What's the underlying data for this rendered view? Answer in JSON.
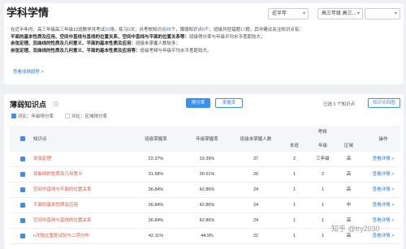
{
  "header": {
    "title": "学科学情",
    "range_select": "近半年",
    "class_select": "高三年级 高三..."
  },
  "summary": {
    "line1_a": "在近半年内，高三年级高三年级12班数学共考试",
    "exams": "15",
    "line1_b": "场，练习",
    "practice": "0",
    "line1_c": "次，共考核知识点",
    "kp_total": "28",
    "line1_d": "个，薄弱知识点",
    "weak": "8",
    "line1_e": "个，班级共性错题",
    "common_wrong": "17",
    "line1_f": "题，其中建议关注知识点有：",
    "line2_bold": "平面的基本性质及应用、空间中直线与直线的位置关系、空间中直线与平面的位置关系等：",
    "line2_rest": "班级得分率与年级平均水平差距较大；",
    "line3_bold": "余弦定理、双曲线的性质及几何意义、平面的基本性质及应用：",
    "line3_rest": "班级未掌握人数较多；",
    "line4_bold": "余弦定理、双曲线的性质及几何意义、平面的基本性质及应用等：",
    "line4_rest": "班级考频与年级平均水平差距较大。",
    "detail_link": "查看成绩趋势 >"
  },
  "weak_section": {
    "title": "薄弱知识点",
    "help": "?",
    "tab_active": "得分率",
    "tab_inactive": "掌握率",
    "selected_prefix": "已选",
    "selected_count": "5",
    "selected_suffix": "个知识点",
    "analyze_button": "知识点四图",
    "compare_prefix_1": "对比：",
    "compare_label_1": "年级得分率",
    "compare_prefix_2": "对比：",
    "compare_label_2": "区域得分率"
  },
  "table": {
    "headers": {
      "kp": "知识点",
      "class_rate": "班级掌握率",
      "grade_rate": "年级掌握率",
      "unmastered": "班级未掌握人数",
      "freq": "考频",
      "freq_class": "本班",
      "freq_grade": "年级",
      "freq_area": "区域",
      "action": "操作"
    },
    "rows": [
      {
        "kp": "余弦定理",
        "class_rate": "22.37%",
        "grade_rate": "19.39%",
        "unmastered": "37",
        "f_class": "2",
        "f_grade": "三年级",
        "f_area": "高",
        "action": "查看详情 >"
      },
      {
        "kp": "双曲线的性质及几何意义",
        "class_rate": "31.58%",
        "grade_rate": "30.61%",
        "unmastered": "26",
        "f_class": "1",
        "f_grade": "2",
        "f_area": "高",
        "action": "查看详情 >"
      },
      {
        "kp": "空间中直线与平面的位置关系",
        "class_rate": "36.84%",
        "grade_rate": "42.86%",
        "unmastered": "24",
        "f_class": "1",
        "f_grade": "1",
        "f_area": "高",
        "action": "查看详情 >"
      },
      {
        "kp": "平面的基本性质及应用",
        "class_rate": "36.84%",
        "grade_rate": "42.86%",
        "unmastered": "24",
        "f_class": "1",
        "f_grade": "1",
        "f_area": "中",
        "action": "查看详情 >"
      },
      {
        "kp": "空间中直线与直线的位置关系",
        "class_rate": "36.84%",
        "grade_rate": "42.86%",
        "unmastered": "24",
        "f_class": "1",
        "f_grade": "1",
        "f_area": "高",
        "action": "查看详情 >"
      },
      {
        "kp": "n次独立重复试验与二项分布",
        "class_rate": "42.11%",
        "grade_rate": "44.9%",
        "unmastered": "22",
        "f_class": "1",
        "f_grade": "1",
        "f_area": "高",
        "action": "查看详情 >"
      }
    ]
  },
  "watermark": "知乎 @try2030",
  "colors": {
    "accent": "#3b8ff0",
    "warning_text": "#e5533c",
    "link": "#2e7bd4"
  }
}
